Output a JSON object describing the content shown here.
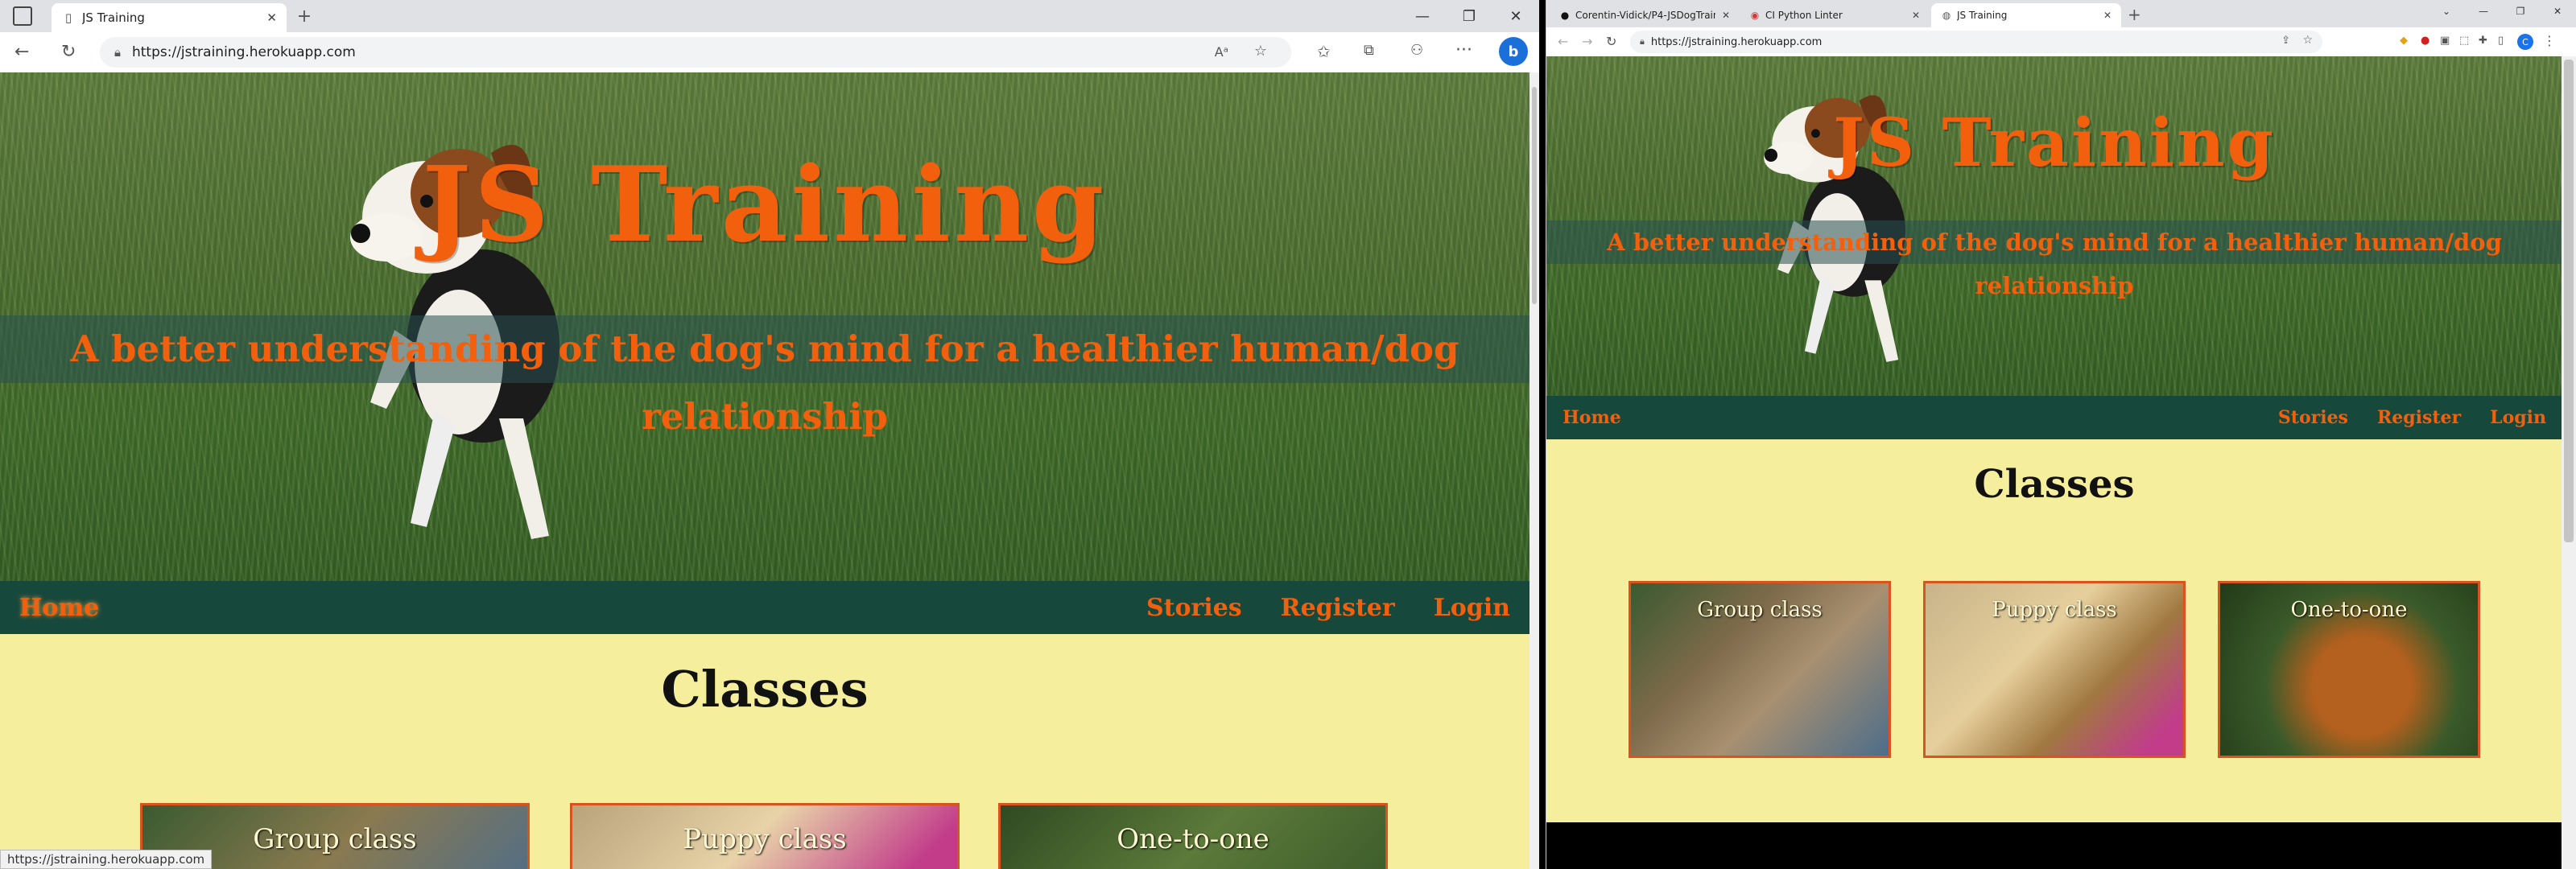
{
  "left_browser": {
    "tab": {
      "title": "JS Training"
    },
    "address": {
      "url": "https://jstraining.herokuapp.com"
    },
    "status_url": "https://jstraining.herokuapp.com"
  },
  "right_browser": {
    "tabs": [
      {
        "title": "Corentin-Vidick/P4-JSDogTrainin"
      },
      {
        "title": "CI Python Linter"
      },
      {
        "title": "JS Training"
      }
    ],
    "address": {
      "url": "https://jstraining.herokuapp.com"
    },
    "profile_initial": "C"
  },
  "site": {
    "title": "JS Training",
    "tagline": "A better understanding of the dog's mind for a healthier human/dog relationship",
    "nav": {
      "home": "Home",
      "stories": "Stories",
      "register": "Register",
      "login": "Login"
    },
    "section_title": "Classes",
    "classes": [
      {
        "label": "Group class"
      },
      {
        "label": "Puppy class"
      },
      {
        "label": "One-to-one"
      }
    ]
  },
  "colors": {
    "accent": "#f2600e",
    "nav_bg": "#17483c",
    "page_bg": "#f5ee9c"
  }
}
